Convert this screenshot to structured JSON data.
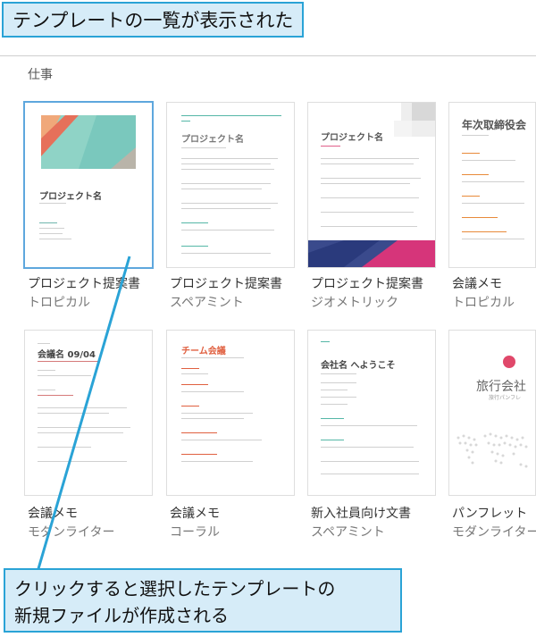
{
  "callouts": {
    "top": "テンプレートの一覧が表示された",
    "bottom_line1": "クリックすると選択したテンプレートの",
    "bottom_line2": "新規ファイルが作成される"
  },
  "section": {
    "title": "仕事"
  },
  "templates": [
    {
      "title": "プロジェクト提案書",
      "subtitle": "トロピカル",
      "preview_heading": "プロジェクト名"
    },
    {
      "title": "プロジェクト提案書",
      "subtitle": "スペアミント",
      "preview_heading": "プロジェクト名"
    },
    {
      "title": "プロジェクト提案書",
      "subtitle": "ジオメトリック",
      "preview_heading": "プロジェクト名"
    },
    {
      "title": "会議メモ",
      "subtitle": "トロピカル",
      "preview_heading": "年次取締役会"
    },
    {
      "title": "会議メモ",
      "subtitle": "モダンライター",
      "preview_heading": "会議名 09/04"
    },
    {
      "title": "会議メモ",
      "subtitle": "コーラル",
      "preview_heading": "チーム会議"
    },
    {
      "title": "新入社員向け文書",
      "subtitle": "スペアミント",
      "preview_heading": "会社名 へようこそ"
    },
    {
      "title": "パンフレット",
      "subtitle": "モダンライター",
      "preview_heading": "旅行会社",
      "preview_subheading": "旅行パンフレ"
    }
  ]
}
